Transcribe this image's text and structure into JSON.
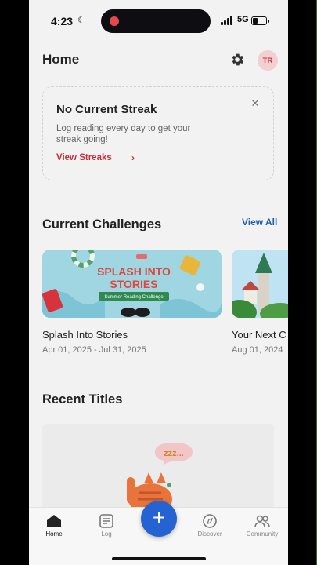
{
  "status_bar": {
    "time": "4:23",
    "network": "5G"
  },
  "header": {
    "title": "Home",
    "avatar_initials": "TR"
  },
  "streak_card": {
    "title": "No Current Streak",
    "description": "Log reading every day to get your streak going!",
    "link_label": "View Streaks"
  },
  "challenges": {
    "section_title": "Current Challenges",
    "view_all_label": "View All",
    "items": [
      {
        "name": "Splash Into Stories",
        "dates": "Apr 01, 2025 - Jul 31, 2025",
        "banner_title_line1": "SPLASH INTO",
        "banner_title_line2": "STORIES",
        "banner_ribbon": "Summer Reading Challenge"
      },
      {
        "name": "Your Next C",
        "dates": "Aug 01, 2024"
      }
    ]
  },
  "recent": {
    "section_title": "Recent Titles",
    "illustration_text": "zzz..."
  },
  "tabbar": {
    "tabs": [
      {
        "label": "Home"
      },
      {
        "label": "Log"
      },
      {
        "label": "Discover"
      },
      {
        "label": "Community"
      }
    ],
    "fab_symbol": "+"
  },
  "colors": {
    "accent_red": "#c0303d",
    "link_blue": "#1f5fa8",
    "fab_blue": "#2463d1",
    "background": "#f2f2f2"
  }
}
